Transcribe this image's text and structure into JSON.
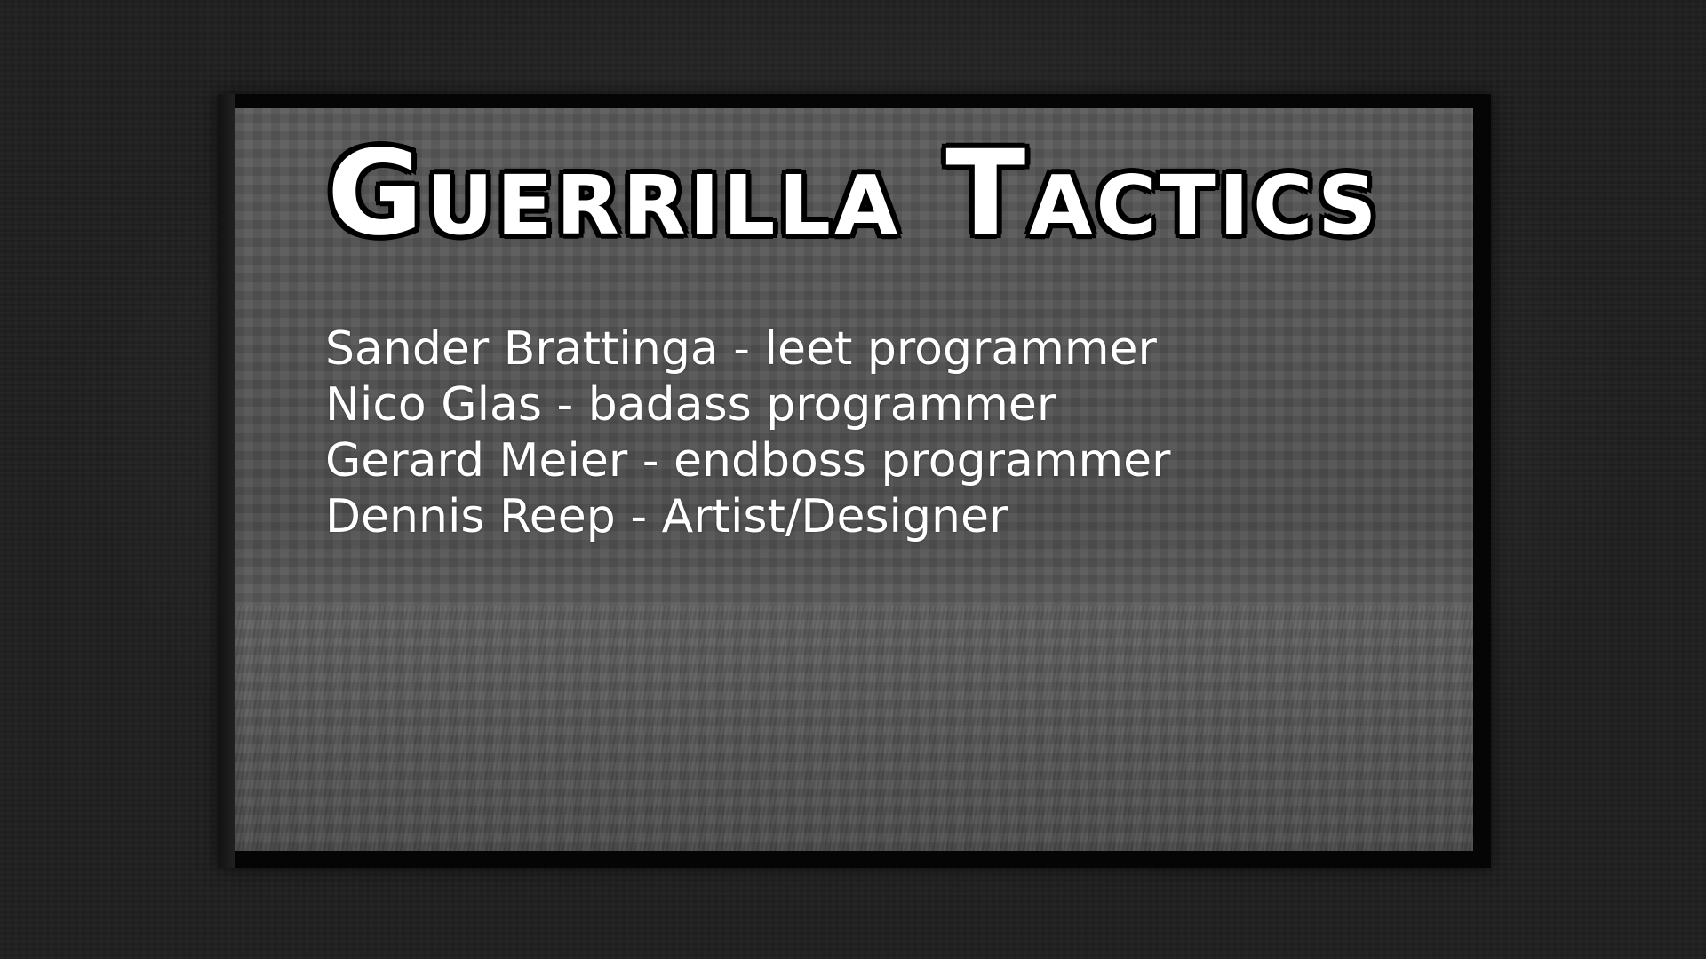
{
  "title": "Guerrilla Tactics",
  "credits": [
    "Sander Brattinga - leet programmer",
    "Nico Glas - badass programmer",
    "Gerard Meier - endboss programmer",
    "Dennis Reep - Artist/Designer"
  ],
  "colors": {
    "background": "#1f1f1f",
    "frame": "#050505",
    "panel": "#555555",
    "text": "#ffffff",
    "title_outline": "#000000"
  }
}
